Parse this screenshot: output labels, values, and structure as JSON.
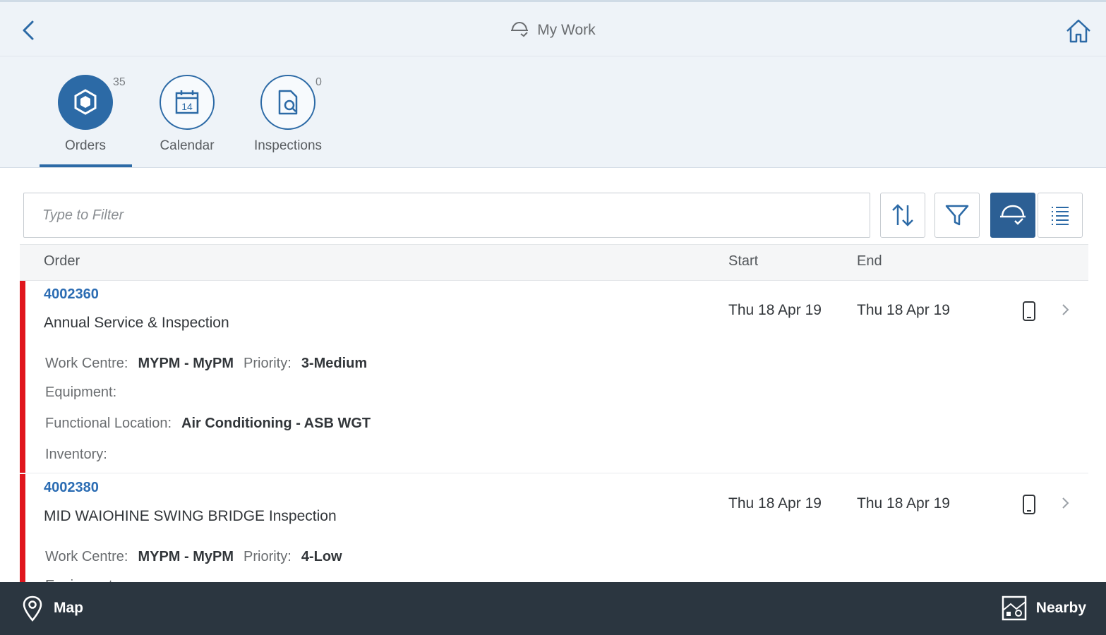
{
  "header": {
    "title": "My Work",
    "back_icon": "chevron-left-icon",
    "home_icon": "home-icon",
    "title_icon": "hardhat-sync-icon"
  },
  "tabs": [
    {
      "label": "Orders",
      "count": "35",
      "icon": "cubes-icon",
      "selected": true
    },
    {
      "label": "Calendar",
      "count": "",
      "icon": "calendar-icon",
      "day": "14"
    },
    {
      "label": "Inspections",
      "count": "0",
      "icon": "document-search-icon"
    }
  ],
  "toolbar": {
    "filter_placeholder": "Type to Filter",
    "sort_icon": "sort-icon",
    "filter_icon": "filter-icon",
    "group_icon": "hardhat-icon",
    "list_icon": "list-icon"
  },
  "table": {
    "columns": {
      "order": "Order",
      "start": "Start",
      "end": "End"
    },
    "rows": [
      {
        "order": "4002360",
        "description": "Annual Service & Inspection",
        "start": "Thu 18 Apr 19",
        "end": "Thu 18 Apr 19",
        "work_centre_label": "Work Centre:",
        "work_centre": "MYPM - MyPM",
        "priority_label": "Priority:",
        "priority": "3-Medium",
        "equipment_label": "Equipment:",
        "functional_location_label": "Functional Location:",
        "functional_location": "Air Conditioning - ASB WGT",
        "inventory_label": "Inventory:"
      },
      {
        "order": "4002380",
        "description": "MID WAIOHINE SWING BRIDGE Inspection",
        "start": "Thu 18 Apr 19",
        "end": "Thu 18 Apr 19",
        "work_centre_label": "Work Centre:",
        "work_centre": "MYPM - MyPM",
        "priority_label": "Priority:",
        "priority": "4-Low",
        "equipment_label": "Equipment:"
      }
    ]
  },
  "footer": {
    "map_label": "Map",
    "map_icon": "map-pin-icon",
    "nearby_label": "Nearby",
    "nearby_icon": "nearby-map-icon"
  },
  "colors": {
    "accent": "#2c6aa6",
    "link": "#2b6cb3",
    "priority_stripe": "#e0161d",
    "footer": "#2b3640",
    "header_bg": "#eef3f8"
  }
}
